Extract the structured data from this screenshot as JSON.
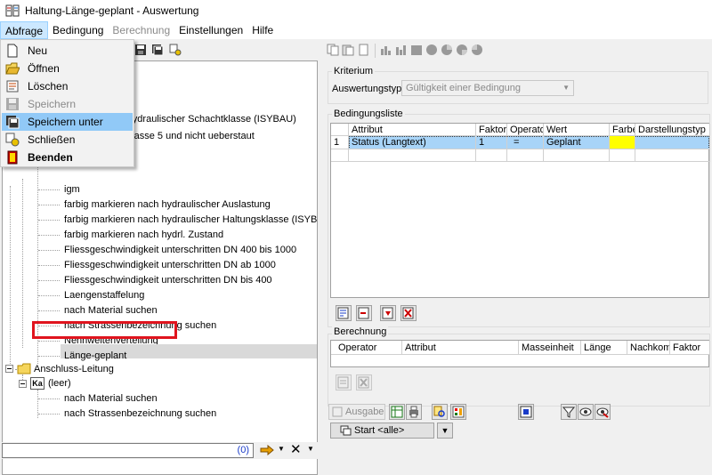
{
  "window": {
    "title": "Haltung-Länge-geplant - Auswertung"
  },
  "menubar": {
    "items": [
      {
        "label": "Abfrage",
        "state": "active"
      },
      {
        "label": "Bedingung",
        "state": "normal"
      },
      {
        "label": "Berechnung",
        "state": "disabled"
      },
      {
        "label": "Einstellungen",
        "state": "normal"
      },
      {
        "label": "Hilfe",
        "state": "normal"
      }
    ]
  },
  "dropdown": {
    "items": [
      {
        "label": "Neu",
        "icon": "new-file-icon",
        "state": "normal"
      },
      {
        "label": "Öffnen",
        "icon": "open-folder-icon",
        "state": "normal"
      },
      {
        "label": "Löschen",
        "icon": "delete-icon",
        "state": "normal"
      },
      {
        "label": "Speichern",
        "icon": "save-icon",
        "state": "disabled"
      },
      {
        "label": "Speichern unter",
        "icon": "save-as-icon",
        "state": "hover"
      },
      {
        "label": "Schließen",
        "icon": "close-query-icon",
        "state": "normal"
      },
      {
        "label": "Beenden",
        "icon": "exit-icon",
        "state": "bold"
      }
    ]
  },
  "tree": {
    "partial_rows": [
      "ch hydraulischer Schachtklasse (ISYBAU)",
      "chtklasse 5 und nicht ueberstaut"
    ],
    "haltung_items": [
      "igm",
      "farbig markieren nach hydraulischer Auslastung",
      "farbig markieren nach hydraulischer Haltungsklasse (ISYBAU)",
      "farbig markieren nach hydrl. Zustand",
      "Fliessgeschwindigkeit unterschritten DN 400 bis 1000",
      "Fliessgeschwindigkeit unterschritten DN ab 1000",
      "Fliessgeschwindigkeit unterschritten DN bis 400",
      "Laengenstaffelung",
      "nach Material suchen",
      "nach Strassenbezeichnung suchen",
      "Nennweitenverteilung",
      "Länge-geplant"
    ],
    "anschluss": {
      "label": "Anschluss-Leitung",
      "child_badge": "Ka",
      "child_label": "(leer)",
      "items": [
        "nach Material suchen",
        "nach Strassenbezeichnung suchen"
      ]
    }
  },
  "filter": {
    "count": "(0)"
  },
  "kriterium": {
    "legend": "Kriterium",
    "type_label": "Auswertungstyp",
    "type_value": "Gültigkeit einer Bedingung"
  },
  "bedingungsliste": {
    "legend": "Bedingungsliste",
    "columns": [
      "Attribut",
      "Faktor",
      "Operator",
      "Wert",
      "Farbe",
      "Darstellungstyp"
    ],
    "rows": [
      {
        "num": "1",
        "attribut": "Status (Langtext)",
        "faktor": "1",
        "operator": "=",
        "wert": "Geplant",
        "farbe": "#ffff00",
        "darstellungstyp": ""
      }
    ]
  },
  "berechnung": {
    "legend": "Berechnung",
    "columns": [
      "Operator",
      "Attribut",
      "Masseinheit",
      "Länge",
      "Nachkomma",
      "Faktor"
    ]
  },
  "buttons": {
    "ausgabe": "Ausgabe",
    "start": "Start <alle>"
  }
}
